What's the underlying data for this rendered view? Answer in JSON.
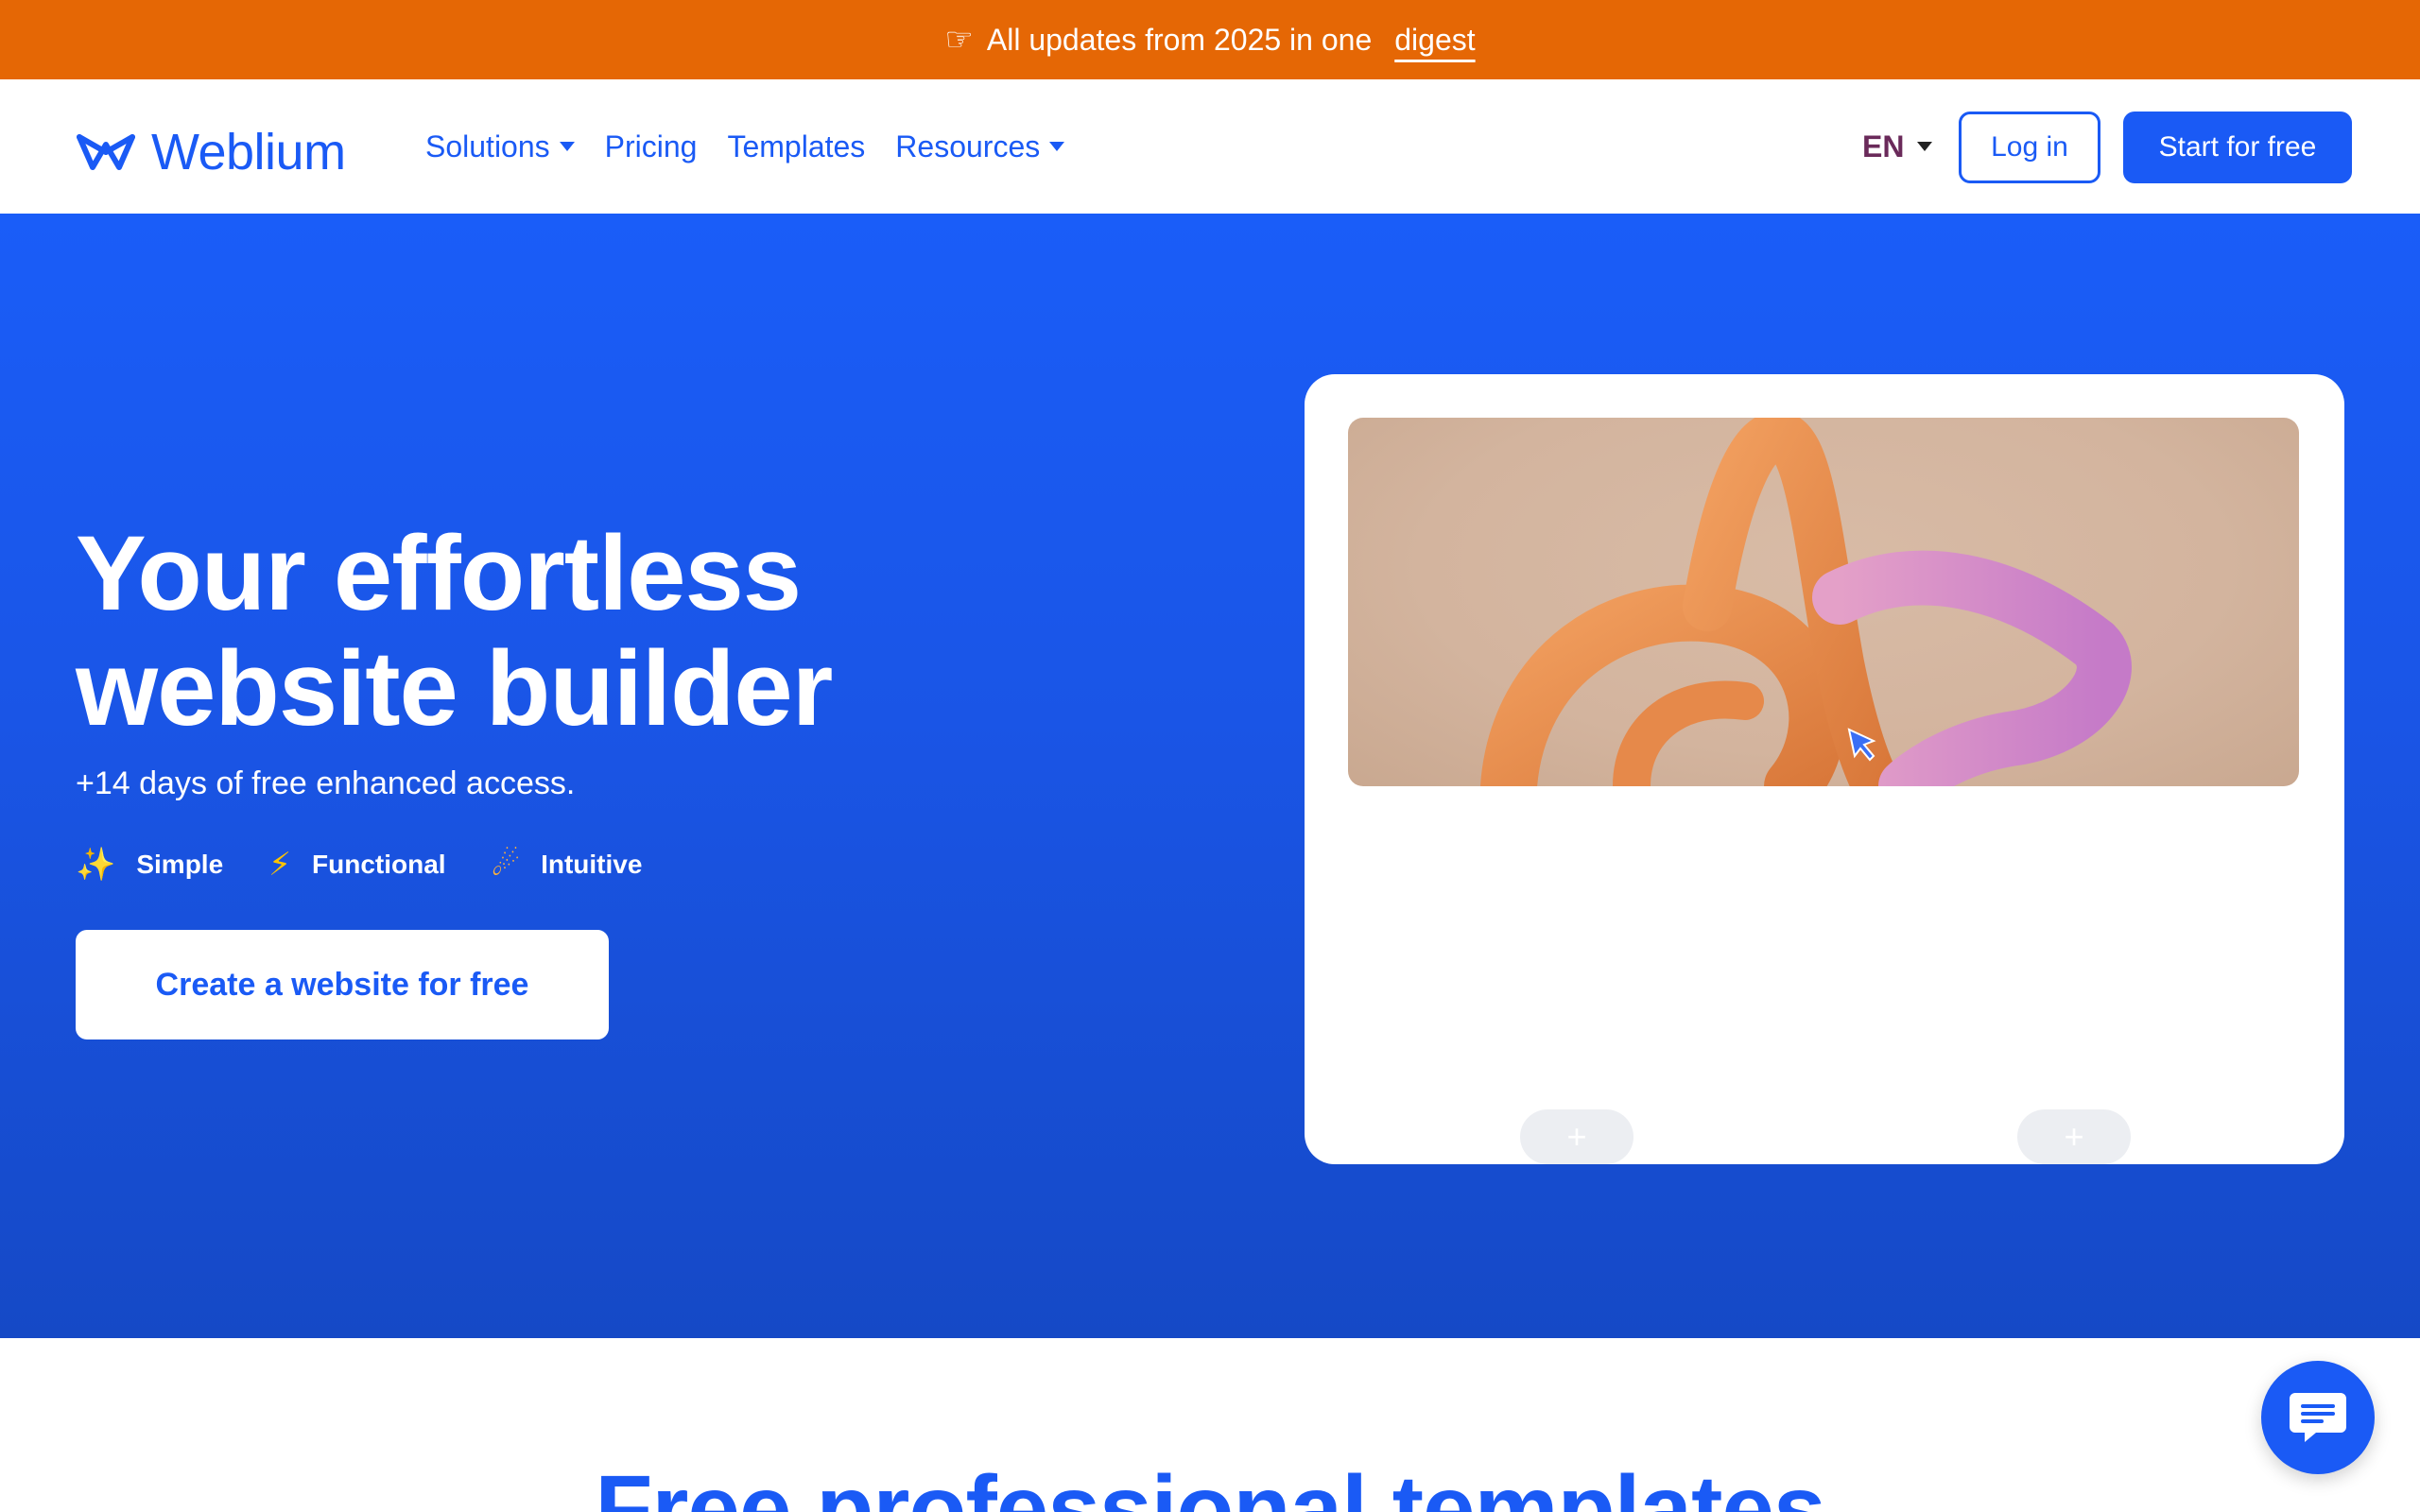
{
  "announcement": {
    "icon": "hand-pointing-right-icon",
    "text": "All updates from 2025 in one",
    "link_label": "digest",
    "background": "#e56705"
  },
  "header": {
    "logo_text": "Weblium",
    "nav": [
      {
        "label": "Solutions",
        "has_dropdown": true
      },
      {
        "label": "Pricing",
        "has_dropdown": false
      },
      {
        "label": "Templates",
        "has_dropdown": false
      },
      {
        "label": "Resources",
        "has_dropdown": true
      }
    ],
    "language": "EN",
    "login_label": "Log in",
    "start_label": "Start for free"
  },
  "hero": {
    "title_line1": "Your effortless",
    "title_line2": "website builder",
    "subtitle": "+14 days of free enhanced access.",
    "features": [
      {
        "icon": "sparkles-icon",
        "label": "Simple"
      },
      {
        "icon": "lightning-icon",
        "label": "Functional"
      },
      {
        "icon": "comet-icon",
        "label": "Intuitive"
      }
    ],
    "cta_label": "Create a website for free"
  },
  "mockup": {
    "plus_label": "+"
  },
  "section": {
    "heading": "Free professional templates"
  },
  "colors": {
    "brand_blue": "#1a5af5",
    "hero_gradient_top": "#1a5df8",
    "hero_gradient_bottom": "#1549c6",
    "accent_orange": "#e56705"
  }
}
